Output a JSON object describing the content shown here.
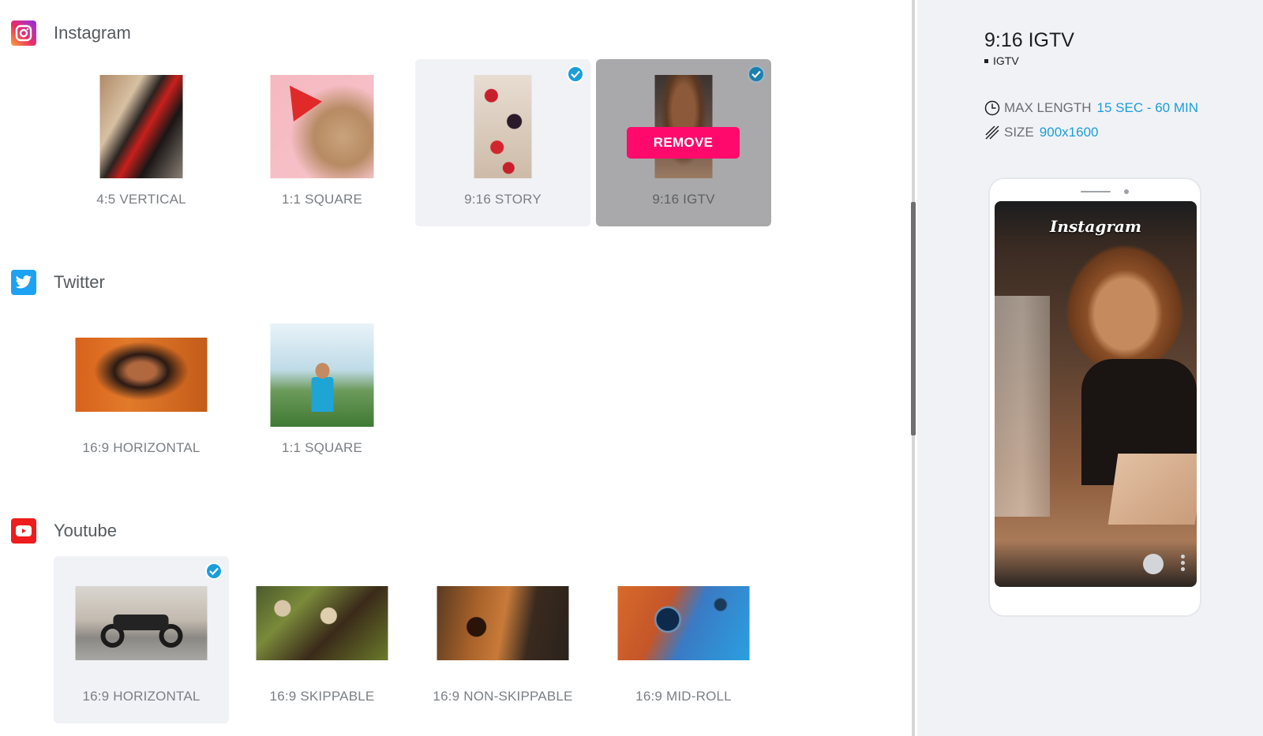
{
  "sections": [
    {
      "name": "Instagram",
      "icon": "instagram-icon",
      "formats": [
        {
          "label": "4:5 VERTICAL",
          "selected": false,
          "thumb": "tango-dancers"
        },
        {
          "label": "1:1 SQUARE",
          "selected": false,
          "thumb": "pug-party-hat"
        },
        {
          "label": "9:16 STORY",
          "selected": true,
          "thumb": "berry-desserts"
        },
        {
          "label": "9:16 IGTV",
          "selected": true,
          "hovered": true,
          "thumb": "woman-laptop",
          "action_label": "REMOVE"
        }
      ]
    },
    {
      "name": "Twitter",
      "icon": "twitter-icon",
      "formats": [
        {
          "label": "16:9 HORIZONTAL",
          "selected": false,
          "thumb": "woman-glasses"
        },
        {
          "label": "1:1 SQUARE",
          "selected": false,
          "thumb": "yoga-woman"
        }
      ]
    },
    {
      "name": "Youtube",
      "icon": "youtube-icon",
      "formats": [
        {
          "label": "16:9 HORIZONTAL",
          "selected": true,
          "thumb": "motorcycle"
        },
        {
          "label": "16:9 SKIPPABLE",
          "selected": false,
          "thumb": "floating-market"
        },
        {
          "label": "16:9 NON-SKIPPABLE",
          "selected": false,
          "thumb": "guitar"
        },
        {
          "label": "16:9 MID-ROLL",
          "selected": false,
          "thumb": "water-droplets"
        }
      ]
    }
  ],
  "detail": {
    "title": "9:16 IGTV",
    "platform": "IGTV",
    "max_length_label": "MAX LENGTH",
    "max_length_value": "15 SEC - 60 MIN",
    "size_label": "SIZE",
    "size_value": "900x1600",
    "preview_brand": "Instagram"
  },
  "colors": {
    "accent": "#1a9ed8",
    "remove": "#ff0a6c",
    "panel_bg": "#f1f2f6"
  }
}
